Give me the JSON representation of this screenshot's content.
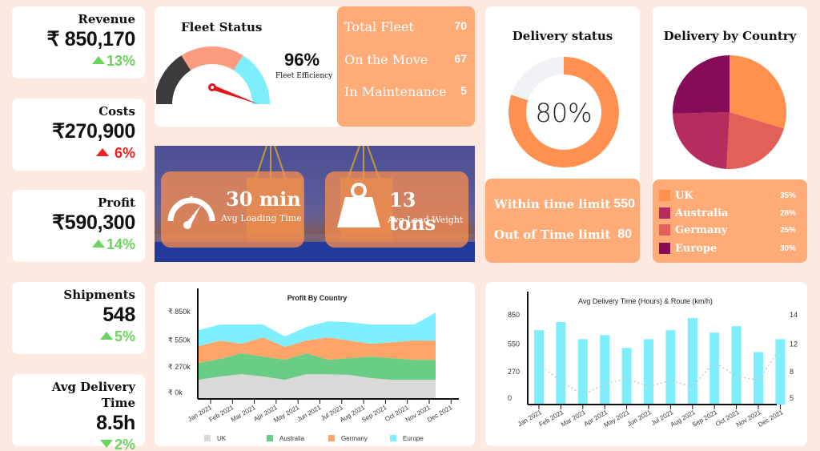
{
  "kpis": [
    {
      "label": "Revenue",
      "value": "₹ 850,170",
      "change": "13%",
      "direction": "up",
      "color": "#6cd35e"
    },
    {
      "label": "Costs",
      "value": "₹270,900",
      "change": " 6%",
      "direction": "up",
      "color": "#f21d1d"
    },
    {
      "label": "Profit",
      "value": "₹590,300",
      "change": "14%",
      "direction": "up",
      "color": "#6cd35e"
    },
    {
      "label": "Shipments",
      "value": "548",
      "change": "5%",
      "direction": "up",
      "color": "#6cd35e"
    },
    {
      "label": "Avg Delivery Time",
      "value": "8.5h",
      "change": "2%",
      "direction": "down",
      "color": "#6cd35e"
    }
  ],
  "fleet": {
    "title": "Fleet Status",
    "efficiency_value": "96%",
    "efficiency_label": "Fleet Efficiency",
    "efficiency_pct": 96,
    "gauge_colors": [
      "#3b3b3b",
      "#fb9b7f",
      "#7eeefc"
    ],
    "needle_color": "#e2141c",
    "stats": [
      {
        "label": "Total Fleet",
        "value": "70"
      },
      {
        "label": "On the Move",
        "value": "67"
      },
      {
        "label": "In Maintenance",
        "value": "5"
      }
    ]
  },
  "banner": {
    "loading": {
      "value": "30 min",
      "label": "Avg Loading Time",
      "icon": "speedometer-icon"
    },
    "weight": {
      "value": "13 tons",
      "label": "Avg Load Weight",
      "icon": "weight-icon"
    }
  },
  "delivery_status": {
    "title": "Delivery status",
    "percent_label": "80%",
    "percent": 80,
    "ring_color": "#ff9150",
    "track_color": "#f0f2f5",
    "rows": [
      {
        "label": "Within time limit",
        "value": "550"
      },
      {
        "label": "Out of Time limit",
        "value": "80"
      }
    ]
  },
  "delivery_by_country": {
    "title": "Delivery by Country",
    "items": [
      {
        "label": "UK",
        "pct": "35%",
        "color": "#ff914d"
      },
      {
        "label": "Australia",
        "pct": "28%",
        "color": "#b72c5e"
      },
      {
        "label": "Germany",
        "pct": "25%",
        "color": "#e35f5a"
      },
      {
        "label": "Europe",
        "pct": "30%",
        "color": "#860c57"
      }
    ]
  },
  "chart_data": [
    {
      "type": "area",
      "title": "Profit By Country",
      "stacked": true,
      "categories": [
        "Jan 2021",
        "Feb 2021",
        "Mar 2021",
        "Apr 2021",
        "May 2021",
        "Jun 2021",
        "Jul 2021",
        "Aug 2021",
        "Sep 2021",
        "Oct 2021",
        "Nov 2021",
        "Dec 2021"
      ],
      "yticks": [
        {
          "value": 0,
          "label": "₹ 0k"
        },
        {
          "value": 270,
          "label": "₹ 270k"
        },
        {
          "value": 550,
          "label": "₹ 550k"
        },
        {
          "value": 850,
          "label": "₹ 850k"
        }
      ],
      "ylim": [
        0,
        850
      ],
      "ylabel": "",
      "xlabel": "",
      "legend_position": "bottom",
      "series": [
        {
          "name": "UK",
          "color": "#d9d9d9",
          "values": [
            134,
            168,
            193,
            168,
            134,
            193,
            193,
            185,
            151,
            134,
            134,
            134
          ]
        },
        {
          "name": "Australia",
          "color": "#69cd86",
          "values": [
            177,
            185,
            219,
            210,
            210,
            219,
            151,
            176,
            227,
            227,
            210,
            210
          ]
        },
        {
          "name": "Germany",
          "color": "#ffa468",
          "values": [
            176,
            193,
            100,
            202,
            135,
            134,
            236,
            185,
            134,
            168,
            202,
            202
          ]
        },
        {
          "name": "Europe",
          "color": "#7defff",
          "values": [
            168,
            168,
            202,
            134,
            109,
            143,
            168,
            193,
            202,
            185,
            168,
            294
          ]
        }
      ]
    },
    {
      "type": "bar",
      "title": "Avg Delivery Time (Hours) & Route (km/h)",
      "categories": [
        "Jan 2021",
        "Feb 2021",
        "Mar 2021",
        "Apr 2021",
        "May 2021",
        "Jun 2021",
        "Jul 2021",
        "Aug 2021",
        "Sep 2021",
        "Oct 2021",
        "Nov 2021",
        "Dec 2021"
      ],
      "left_yticks": [
        {
          "value": 0,
          "label": "0"
        },
        {
          "value": 270,
          "label": "270"
        },
        {
          "value": 550,
          "label": "550"
        },
        {
          "value": 850,
          "label": "850"
        }
      ],
      "right_yticks": [
        {
          "value": 5,
          "label": "5"
        },
        {
          "value": 8,
          "label": "8"
        },
        {
          "value": 12,
          "label": "12"
        },
        {
          "value": 14,
          "label": "14"
        }
      ],
      "ylim": [
        0,
        850
      ],
      "series": [
        {
          "name": "Avg Delivery Time",
          "type": "bar",
          "axis": "left",
          "color": "#7eeefc",
          "values": [
            693,
            776,
            602,
            644,
            512,
            602,
            693,
            817,
            668,
            734,
            470,
            602
          ]
        },
        {
          "name": "Route",
          "type": "line",
          "axis": "right",
          "style": "dotted",
          "color": "#c8c8c8",
          "values": [
            9.1,
            6.9,
            5.4,
            6.6,
            7.2,
            6.3,
            7.0,
            6.3,
            9.4,
            7.5,
            7.0,
            11.4
          ]
        }
      ]
    }
  ]
}
